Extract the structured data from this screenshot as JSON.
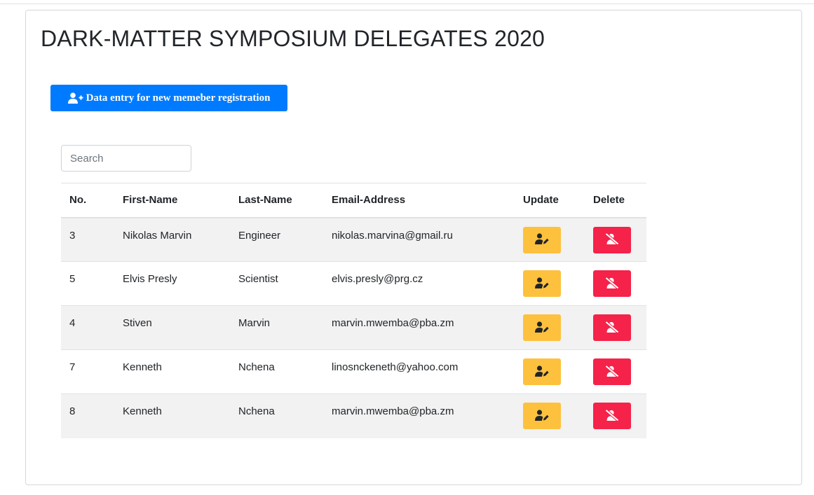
{
  "page": {
    "title": "DARK-MATTER SYMPOSIUM DELEGATES 2020"
  },
  "toolbar": {
    "add_label": "Data entry for new memeber registration",
    "add_icon": "user-plus-icon"
  },
  "search": {
    "placeholder": "Search",
    "value": ""
  },
  "table": {
    "headers": [
      "No.",
      "First-Name",
      "Last-Name",
      "Email-Address",
      "Update",
      "Delete"
    ],
    "rows": [
      {
        "no": "3",
        "first": "Nikolas Marvin",
        "last": "Engineer",
        "email": "nikolas.marvina@gmail.ru"
      },
      {
        "no": "5",
        "first": "Elvis Presly",
        "last": "Scientist",
        "email": "elvis.presly@prg.cz"
      },
      {
        "no": "4",
        "first": "Stiven",
        "last": "Marvin",
        "email": "marvin.mwemba@pba.zm"
      },
      {
        "no": "7",
        "first": "Kenneth",
        "last": "Nchena",
        "email": "linosnckeneth@yahoo.com"
      },
      {
        "no": "8",
        "first": "Kenneth",
        "last": "Nchena",
        "email": "marvin.mwemba@pba.zm"
      }
    ],
    "update_icon": "user-edit-icon",
    "delete_icon": "user-slash-icon"
  },
  "colors": {
    "primary": "#007bff",
    "update": "#fdc13d",
    "delete": "#f5224a",
    "stripe": "#f2f2f2"
  }
}
